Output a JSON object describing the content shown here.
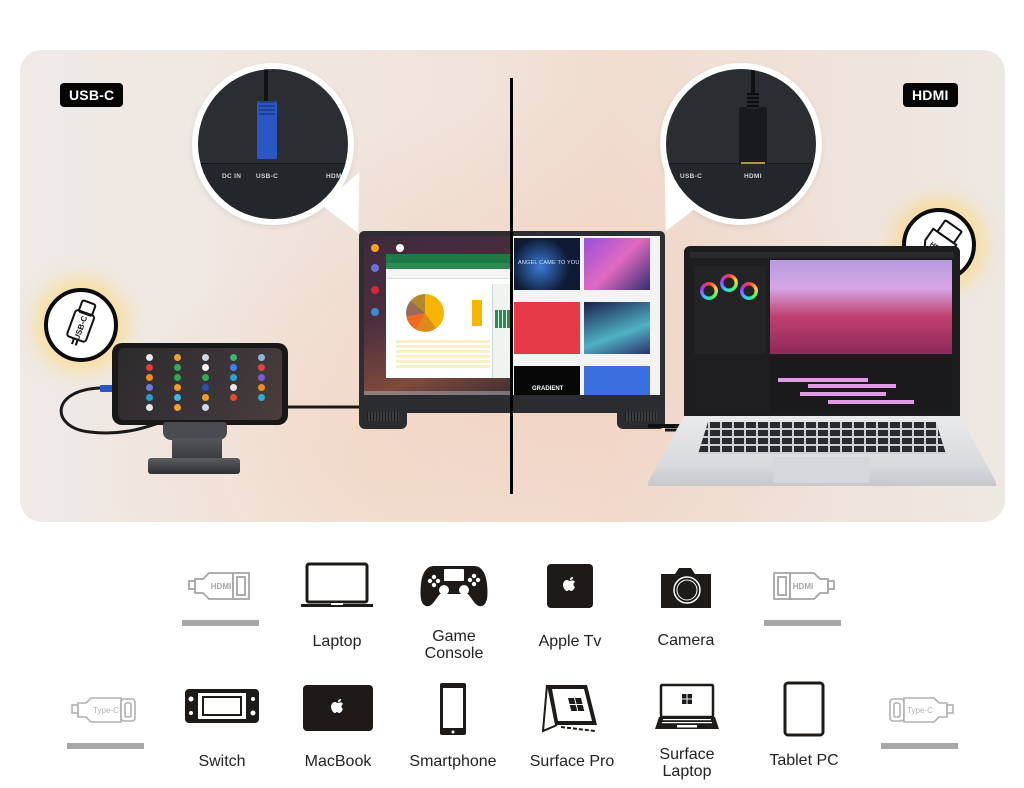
{
  "hero": {
    "left_tag": "USB-C",
    "right_tag": "HDMI",
    "left_bubble_ports": [
      "DC IN",
      "USB-C",
      "HDMI"
    ],
    "right_bubble_ports": [
      "USB-C",
      "HDMI"
    ],
    "usbc_badge_text": "USB-C",
    "hdmi_badge_text": "HDMI",
    "monitor_right_screen_text": "ANGEL CAME TO YOU",
    "monitor_right_tile_text": "GRADIENT",
    "colors": {
      "tag_bg": "#050505",
      "usb_cable": "#2a57c4",
      "glow": "#ffd666",
      "excel_green": "#1f7a45"
    }
  },
  "connectors": {
    "hdmi_label": "HDMI",
    "typec_label": "Type-C"
  },
  "row1": {
    "devices": [
      {
        "icon": "laptop-icon",
        "label": "Laptop"
      },
      {
        "icon": "game-controller-icon",
        "label_line1": "Game",
        "label_line2": "Console"
      },
      {
        "icon": "apple-tv-icon",
        "label": "Apple Tv"
      },
      {
        "icon": "camera-icon",
        "label": "Camera"
      }
    ]
  },
  "row2": {
    "devices": [
      {
        "icon": "switch-console-icon",
        "label": "Switch"
      },
      {
        "icon": "macbook-icon",
        "label": "MacBook"
      },
      {
        "icon": "smartphone-icon",
        "label": "Smartphone"
      },
      {
        "icon": "surface-pro-icon",
        "label": "Surface Pro"
      },
      {
        "icon": "surface-laptop-icon",
        "label_line1": "Surface",
        "label_line2": "Laptop"
      },
      {
        "icon": "tablet-icon",
        "label": "Tablet PC"
      }
    ]
  }
}
